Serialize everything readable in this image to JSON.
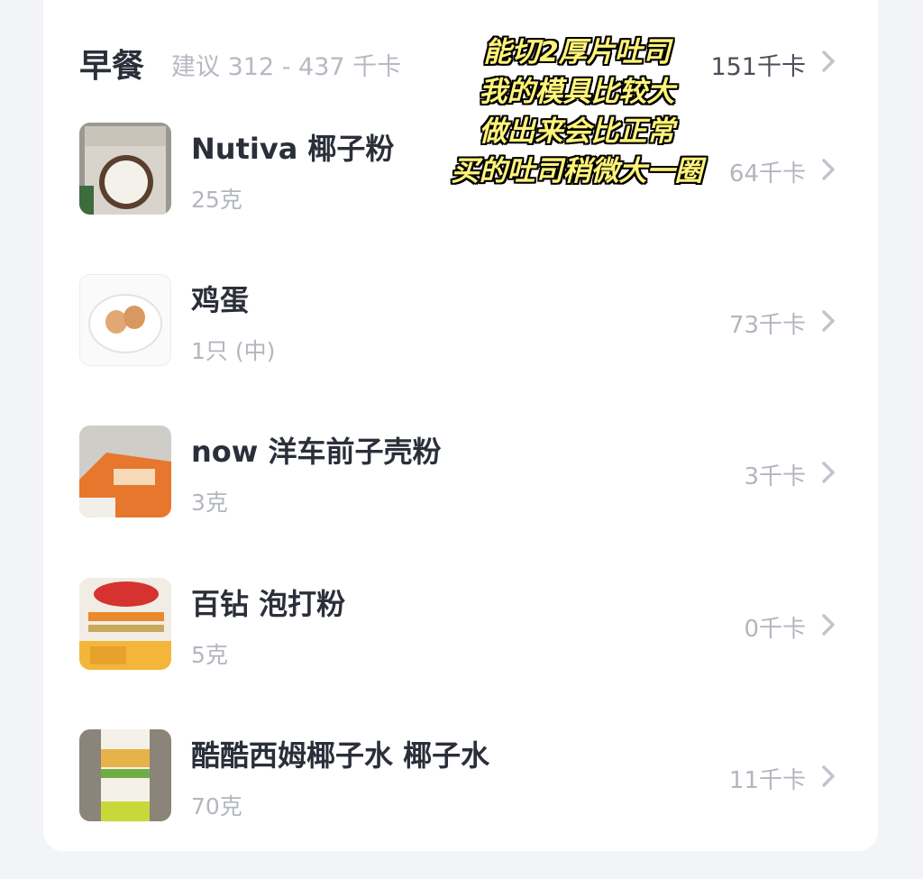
{
  "meal": {
    "title": "早餐",
    "suggestion": "建议 312 - 437 千卡",
    "total_kcal": "151千卡"
  },
  "foods": [
    {
      "name": "Nutiva 椰子粉",
      "amount": "25克",
      "kcal": "64千卡",
      "thumb": "coconut-flour"
    },
    {
      "name": "鸡蛋",
      "amount": "1只 (中)",
      "kcal": "73千卡",
      "thumb": "eggs"
    },
    {
      "name": "now 洋车前子壳粉",
      "amount": "3克",
      "kcal": "3千卡",
      "thumb": "psyllium"
    },
    {
      "name": "百钻 泡打粉",
      "amount": "5克",
      "kcal": "0千卡",
      "thumb": "baking-powder"
    },
    {
      "name": "酷酷西姆椰子水 椰子水",
      "amount": "70克",
      "kcal": "11千卡",
      "thumb": "coconut-water"
    }
  ],
  "overlay_note": {
    "lines": [
      "能切2厚片吐司",
      "我的模具比较大",
      "做出来会比正常",
      "买的吐司稍微大一圈"
    ],
    "color": "#fff37a"
  },
  "icons": {
    "chevron": "chevron-right-icon"
  }
}
